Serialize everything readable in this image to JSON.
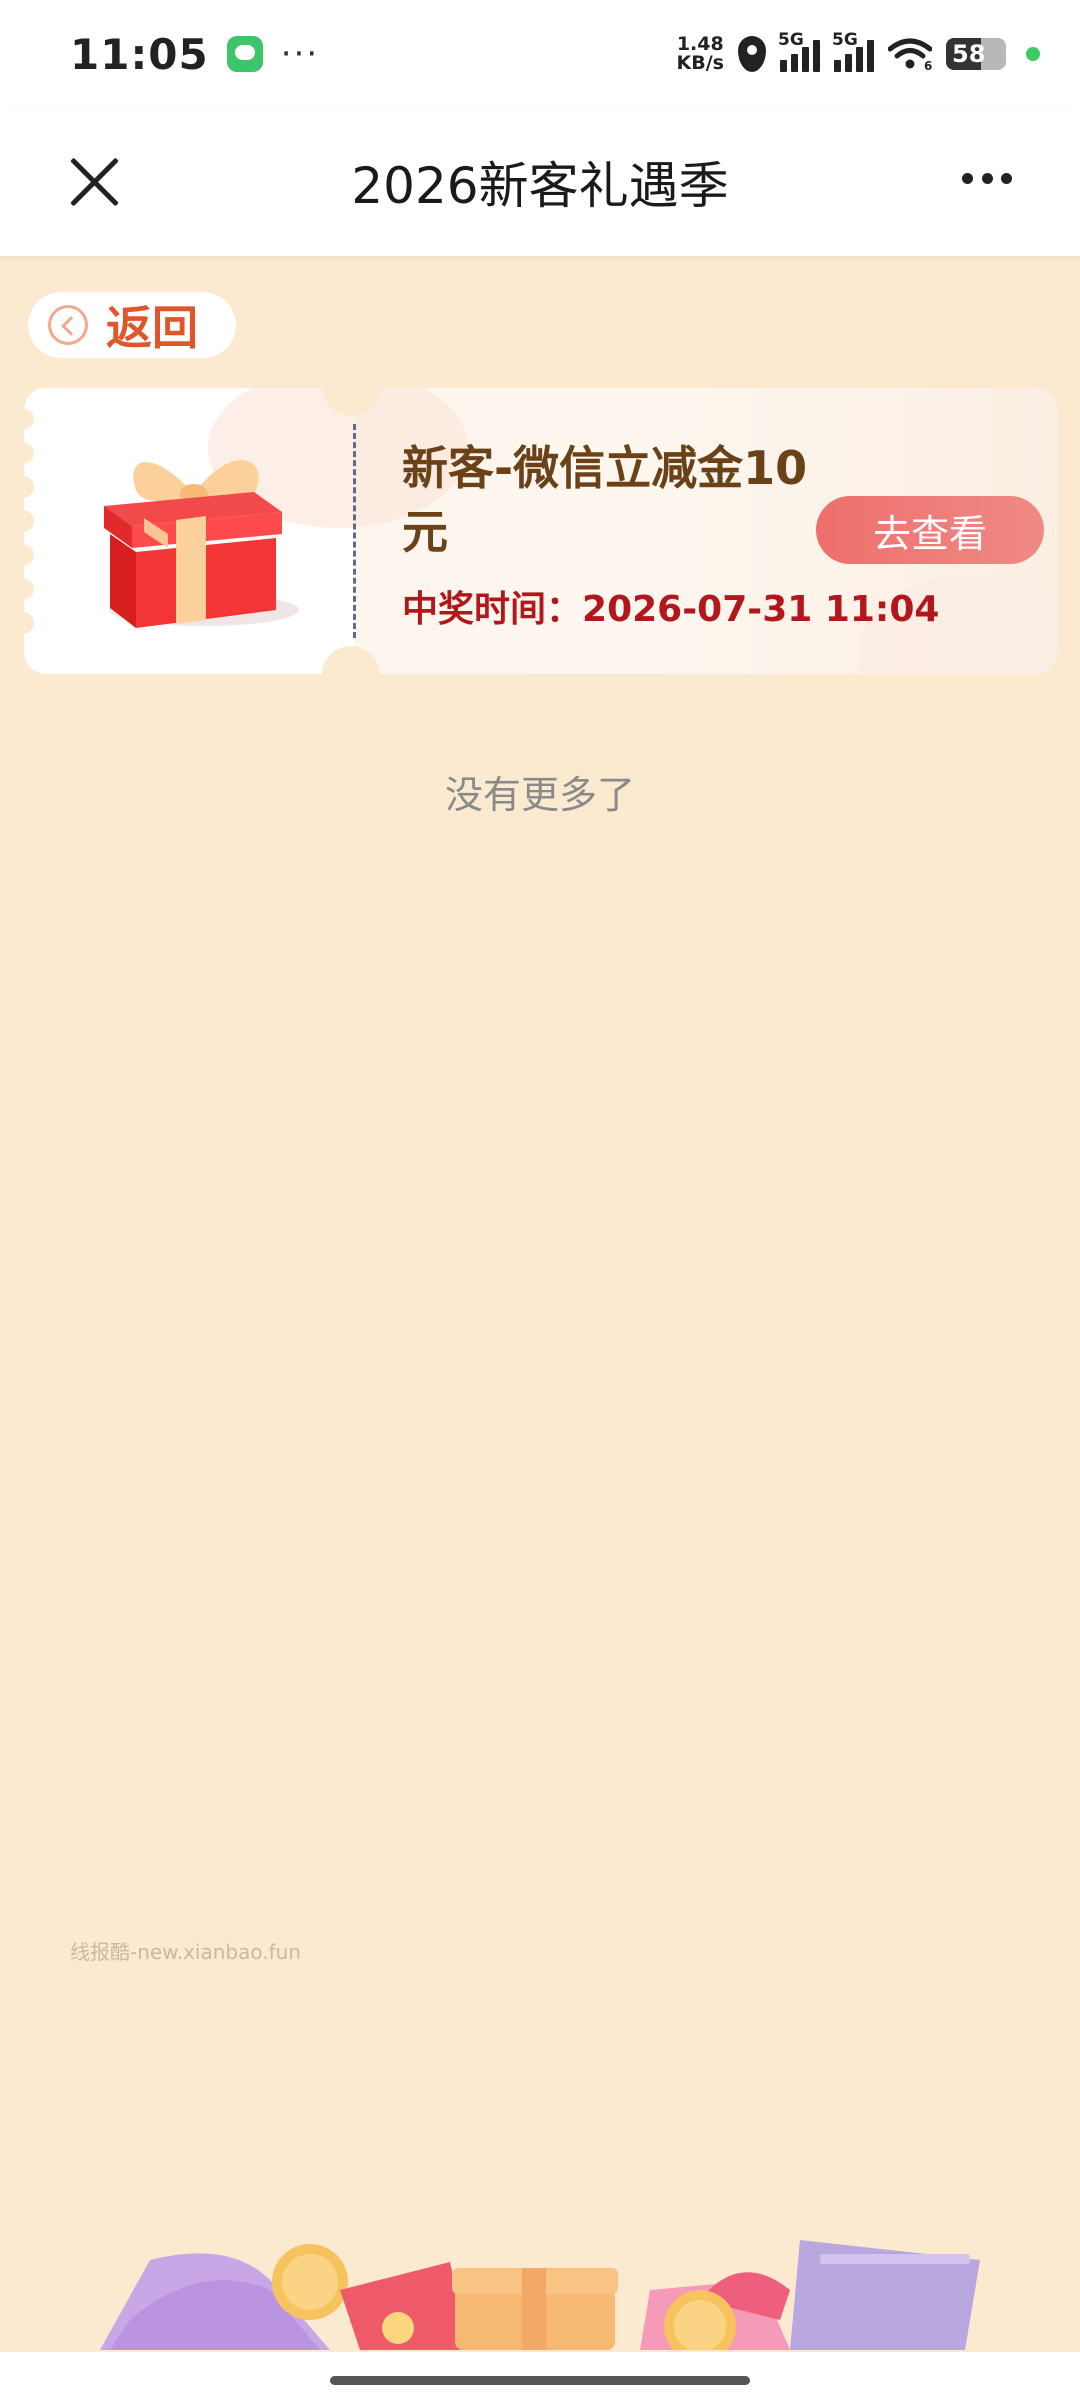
{
  "status_bar": {
    "time": "11:05",
    "dots": "···",
    "net_speed_value": "1.48",
    "net_speed_unit": "KB/s",
    "signal1_label": "5G",
    "signal2_label": "5G",
    "wifi_badge": "6",
    "battery_level": "58"
  },
  "nav": {
    "title": "2026新客礼遇季"
  },
  "back": {
    "label": "返回"
  },
  "prize": {
    "title": "新客-微信立减金10元",
    "time_label": "中奖时间：",
    "time_value": "2026-07-31 11:04",
    "button_label": "去查看"
  },
  "list": {
    "end_text": "没有更多了"
  },
  "watermark": "线报酷-new.xianbao.fun",
  "colors": {
    "page_bg": "#fbead0",
    "accent_red": "#e0562b",
    "prize_title": "#6b4218",
    "prize_time": "#b3171b",
    "button_bg": "#ee6f6d"
  }
}
